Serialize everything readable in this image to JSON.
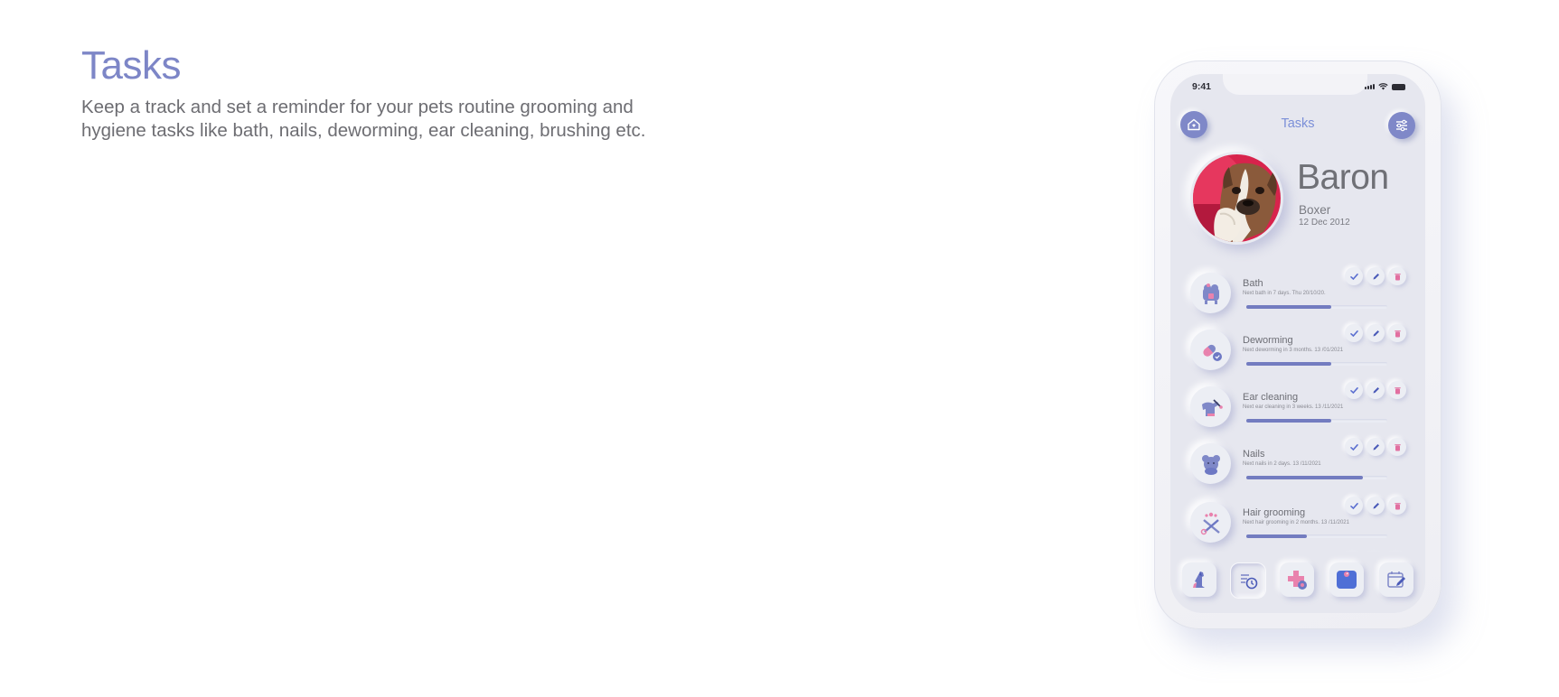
{
  "intro": {
    "title": "Tasks",
    "description_line1": "Keep a track and set a reminder for your pets routine grooming and",
    "description_line2": "hygiene tasks like bath, nails, deworming, ear cleaning, brushing etc."
  },
  "phone": {
    "status_time": "9:41",
    "header_title": "Tasks",
    "home_icon": "home-icon",
    "filter_icon": "sliders-icon"
  },
  "pet": {
    "name": "Baron",
    "breed": "Boxer",
    "dob": "12 Dec 2012"
  },
  "tasks": [
    {
      "name": "Bath",
      "sub": "Next bath in 7 days.  Thu 20/10/20.",
      "progress": 0.6,
      "icon": "bathtub-icon"
    },
    {
      "name": "Deworming",
      "sub": "Next deworming in  3 months.  13 /01/2021",
      "progress": 0.6,
      "icon": "pill-icon"
    },
    {
      "name": "Ear cleaning",
      "sub": "Next ear cleaning  in  3 weeks.  13 /11/2021",
      "progress": 0.6,
      "icon": "ear-cleaning-icon"
    },
    {
      "name": "Nails",
      "sub": "Next nails  in  2  days.  13 /11/2021",
      "progress": 0.83,
      "icon": "nails-icon"
    },
    {
      "name": "Hair grooming",
      "sub": "Next hair grooming  in  2  months.  13 /11/2021",
      "progress": 0.43,
      "icon": "scissors-paw-icon"
    }
  ],
  "bottom_nav": [
    {
      "icon": "dog-icon",
      "active": false
    },
    {
      "icon": "task-list-clock-icon",
      "active": true
    },
    {
      "icon": "medical-cross-icon",
      "active": false
    },
    {
      "icon": "weight-scale-icon",
      "active": false
    },
    {
      "icon": "calendar-edit-icon",
      "active": false
    }
  ],
  "colors": {
    "accent": "#7d86c7",
    "progress": "#737cc0",
    "check": "#5b6fd0",
    "trash": "#e26fa0",
    "background": "#e6e7ef"
  }
}
